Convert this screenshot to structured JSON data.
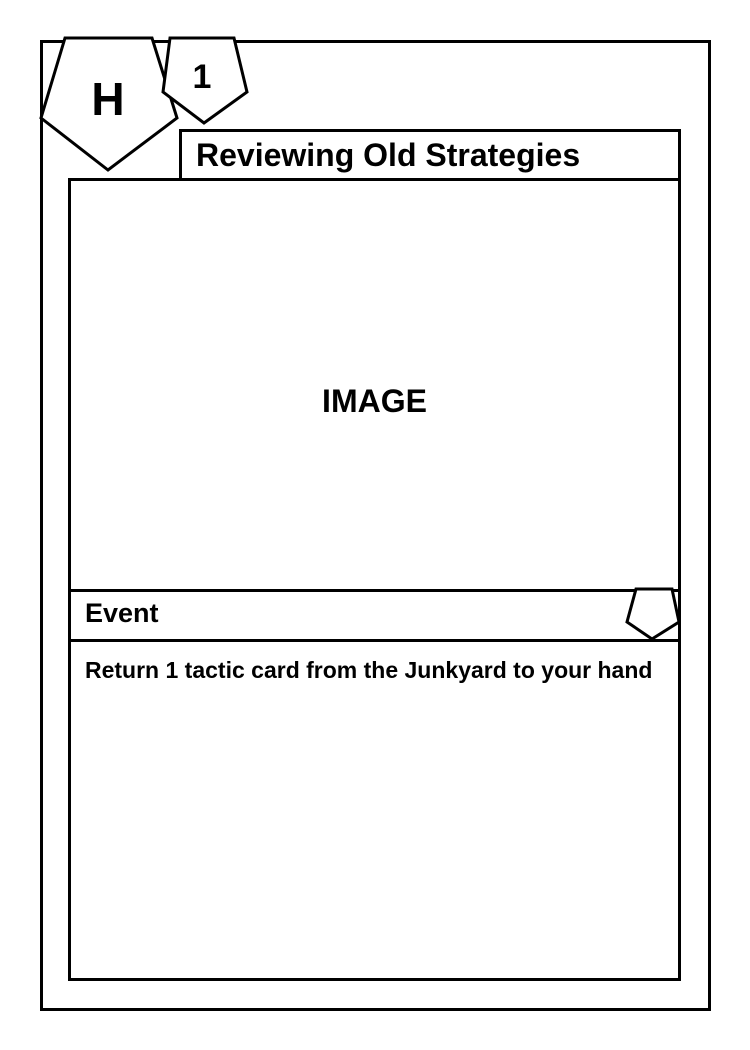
{
  "card": {
    "title": "Reviewing Old Strategies",
    "image_placeholder": "IMAGE",
    "type": "Event",
    "rules_text": "Return 1 tactic card from the Junkyard to your hand",
    "corner_badge": "H",
    "cost_badge": "1"
  },
  "icons": {
    "corner_badge_shape": "pentagon-icon",
    "cost_badge_shape": "pentagon-icon",
    "type_badge_shape": "pentagon-icon"
  },
  "colors": {
    "stroke": "#000000",
    "fill": "#ffffff"
  }
}
